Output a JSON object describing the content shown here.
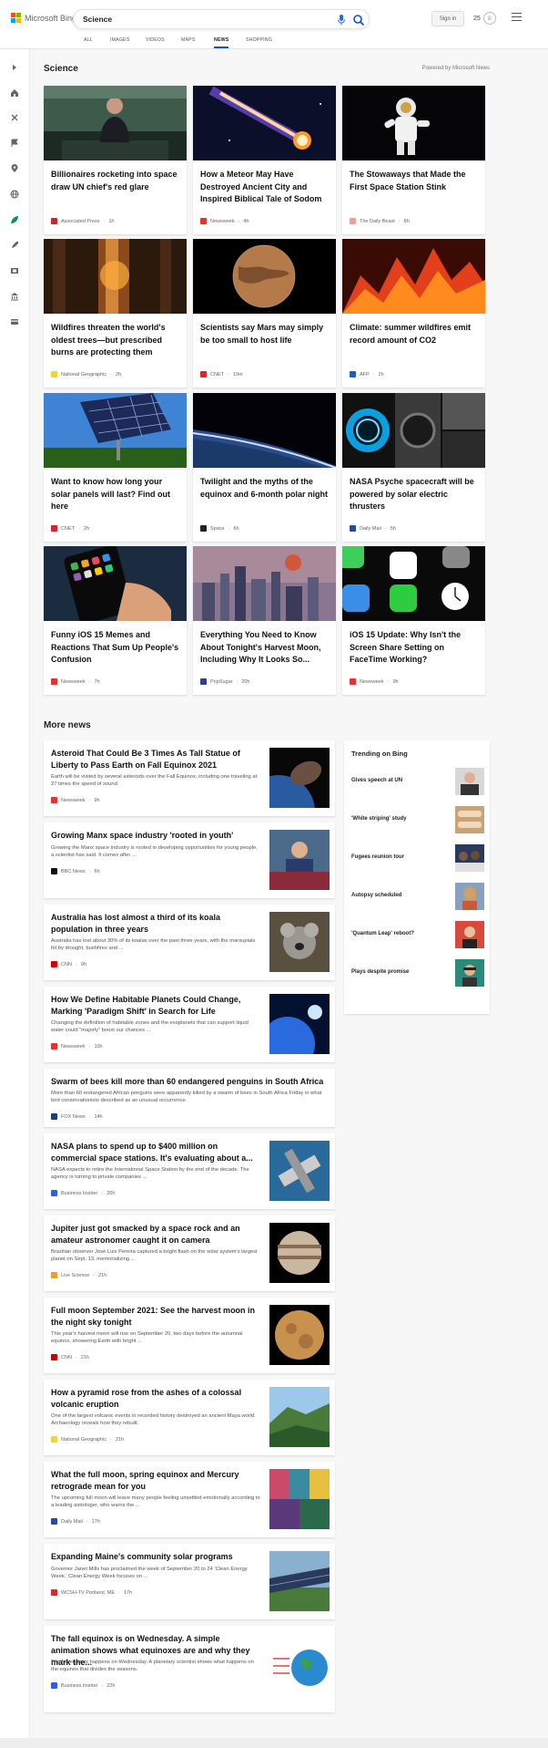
{
  "header": {
    "brand": "Microsoft Bing",
    "search_query": "Science",
    "signin_label": "Sign in",
    "rewards_count": "25",
    "tabs": [
      {
        "label": "ALL"
      },
      {
        "label": "IMAGES"
      },
      {
        "label": "VIDEOS"
      },
      {
        "label": "MAPS"
      },
      {
        "label": "NEWS",
        "active": true
      },
      {
        "label": "SHOPPING"
      }
    ]
  },
  "sidebar": {
    "icons": [
      "expand-arrow-icon",
      "home-icon",
      "science-icon",
      "flag-icon",
      "location-pin-icon",
      "globe-icon",
      "leaf-icon",
      "rocket-icon",
      "film-icon",
      "bank-icon",
      "card-icon"
    ]
  },
  "section": {
    "title": "Science",
    "powered_by": "Powered by Microsoft News"
  },
  "top_cards": [
    {
      "title": "Billionaires rocketing into space draw UN chief's red glare",
      "source": "Associated Press",
      "time": "1h",
      "color": "#c8262f"
    },
    {
      "title": "How a Meteor May Have Destroyed Ancient City and Inspired Biblical Tale of Sodom",
      "source": "Newsweek",
      "time": "4h",
      "color": "#e3342f"
    },
    {
      "title": "The Stowaways that Made the First Space Station Stink",
      "source": "The Daily Beast",
      "time": "8h",
      "color": "#e9a0a0"
    },
    {
      "title": "Wildfires threaten the world's oldest trees—but prescribed burns are protecting them",
      "source": "National Geographic",
      "time": "2h",
      "color": "#f3d13b"
    },
    {
      "title": "Scientists say Mars may simply be too small to host life",
      "source": "CNET",
      "time": "19m",
      "color": "#d6262f"
    },
    {
      "title": "Climate: summer wildfires emit record amount of CO2",
      "source": "AFP",
      "time": "2h",
      "color": "#1f5fb3"
    },
    {
      "title": "Want to know how long your solar panels will last? Find out here",
      "source": "CNET",
      "time": "2h",
      "color": "#d6262f"
    },
    {
      "title": "Twilight and the myths of the equinox and 6-month polar night",
      "source": "Space",
      "time": "6h",
      "color": "#222222"
    },
    {
      "title": "NASA Psyche spacecraft will be powered by solar electric thrusters",
      "source": "Daily Mail",
      "time": "5h",
      "color": "#2a4d9b"
    },
    {
      "title": "Funny iOS 15 Memes and Reactions That Sum Up People's Confusion",
      "source": "Newsweek",
      "time": "7h",
      "color": "#e3342f"
    },
    {
      "title": "Everything You Need to Know About Tonight's Harvest Moon, Including Why It Looks So...",
      "source": "PopSugar",
      "time": "20h",
      "color": "#3a3a8a"
    },
    {
      "title": "iOS 15 Update: Why Isn't the Screen Share Setting on FaceTime Working?",
      "source": "Newsweek",
      "time": "9h",
      "color": "#e3342f"
    }
  ],
  "more_news": {
    "title": "More news",
    "items": [
      {
        "title": "Asteroid That Could Be 3 Times As Tall Statue of Liberty to Pass Earth on Fall Equinox 2021",
        "desc": "Earth will be visited by several asteroids over the Fall Equinox, including one traveling at 27 times the speed of sound.",
        "source": "Newsweek",
        "time": "9h",
        "color": "#e3342f"
      },
      {
        "title": "Growing Manx space industry 'rooted in youth'",
        "desc": "Growing the Manx space industry is rooted in developing opportunities for young people, a scientist has said. It comes after ...",
        "source": "BBC News",
        "time": "6h",
        "color": "#111111"
      },
      {
        "title": "Australia has lost almost a third of its koala population in three years",
        "desc": "Australia has lost about 30% of its koalas over the past three years, with the marsupials hit by drought, bushfires and ...",
        "source": "CNN",
        "time": "9h",
        "color": "#cc0000"
      },
      {
        "title": "How We Define Habitable Planets Could Change, Marking 'Paradigm Shift' in Search for Life",
        "desc": "Changing the definition of habitable zones and the exoplanets that can support liquid water could \"majorly\" boost our chances ...",
        "source": "Newsweek",
        "time": "10h",
        "color": "#e3342f"
      },
      {
        "title": "Swarm of bees kill more than 60 endangered penguins in South Africa",
        "desc": "More than 60 endangered African penguins were apparently killed by a swarm of bees in South Africa Friday in what bird conservationists described as an unusual occurrence.",
        "source": "FOX News",
        "time": "14h",
        "color": "#1d3d7a"
      },
      {
        "title": "NASA plans to spend up to $400 million on commercial space stations. It's evaluating about a...",
        "desc": "NASA expects to retire the International Space Station by the end of the decade. The agency is turning to private companies ...",
        "source": "Business Insider",
        "time": "20h",
        "color": "#2f5fe0"
      },
      {
        "title": "Jupiter just got smacked by a space rock and an amateur astronomer caught it on camera",
        "desc": "Brazilian observer José Luis Pereira captured a bright flash on the solar system's largest planet on Sept. 13, memorializing ...",
        "source": "Live Science",
        "time": "21h",
        "color": "#e8a317"
      },
      {
        "title": "Full moon September 2021: See the harvest moon in the night sky tonight",
        "desc": "This year's harvest moon will rise on September 20, two days before the autumnal equinox, showering Earth with bright ...",
        "source": "CNN",
        "time": "21h",
        "color": "#cc0000"
      },
      {
        "title": "How a pyramid rose from the ashes of a colossal volcanic eruption",
        "desc": "One of the largest volcanic events in recorded history destroyed an ancient Maya world. Archaeology reveals how they rebuilt.",
        "source": "National Geographic",
        "time": "21h",
        "color": "#f3d13b"
      },
      {
        "title": "What the full moon, spring equinox and Mercury retrograde mean for you",
        "desc": "The upcoming full moon will leave many people feeling unsettled emotionally according to a leading astrologer, who warns the ...",
        "source": "Daily Mail",
        "time": "17h",
        "color": "#2a4d9b"
      },
      {
        "title": "Expanding Maine's community solar programs",
        "desc": "Governor Janet Mills has proclaimed the week of September 20 to 24 'Clean Energy Week.' Clean Energy Week focuses on ...",
        "source": "WCSH-TV Portland, ME",
        "time": "17h",
        "color": "#d62a2a"
      },
      {
        "title": "The fall equinox is on Wednesday. A simple animation shows what equinoxes are and why they mark the...",
        "desc": "The fall equinox happens on Wednesday. A planetary scientist shows what happens on the equinox that divides the seasons.",
        "source": "Business Insider",
        "time": "22h",
        "color": "#2f5fe0"
      }
    ]
  },
  "trending": {
    "title": "Trending on Bing",
    "items": [
      {
        "label": "Gives speech at UN"
      },
      {
        "label": "'White striping' study"
      },
      {
        "label": "Fugees reunion tour"
      },
      {
        "label": "Autopsy scheduled"
      },
      {
        "label": "'Quantum Leap' reboot?"
      },
      {
        "label": "Plays despite promise"
      }
    ]
  }
}
